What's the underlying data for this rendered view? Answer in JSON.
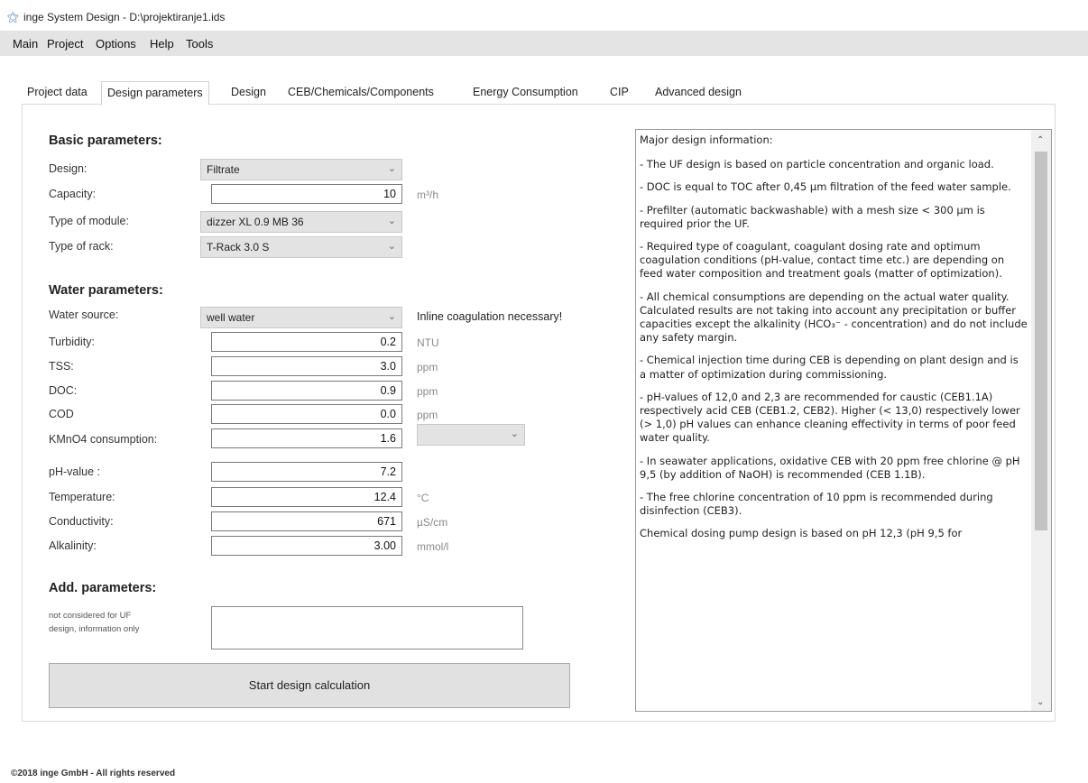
{
  "window": {
    "title": "inge System Design - D:\\projektiranje1.ids",
    "icon": "app-logo-icon"
  },
  "menu": [
    "Main",
    "Project",
    "Options",
    "Help",
    "Tools"
  ],
  "tabs": [
    "Project data",
    "Design parameters",
    "Design",
    "CEB/Chemicals/Components",
    "Energy Consumption",
    "CIP",
    "Advanced design"
  ],
  "active_tab": "Design parameters",
  "basic": {
    "title": "Basic parameters:",
    "design_label": "Design:",
    "design_value": "Filtrate",
    "capacity_label": "Capacity:",
    "capacity_value": "10",
    "capacity_unit": "m³/h",
    "module_label": "Type of module:",
    "module_value": "dizzer XL 0.9 MB 36",
    "rack_label": "Type of rack:",
    "rack_value": "T-Rack 3.0 S"
  },
  "water": {
    "title": "Water parameters:",
    "source_label": "Water source:",
    "source_value": "well water",
    "note": "Inline coagulation necessary!",
    "turbidity_label": "Turbidity:",
    "turbidity_value": "0.2",
    "turbidity_unit": "NTU",
    "tss_label": "TSS:",
    "tss_value": "3.0",
    "tss_unit": "ppm",
    "doc_label": "DOC:",
    "doc_value": "0.9",
    "doc_unit": "ppm",
    "cod_label": "COD",
    "cod_value": "0.0",
    "cod_unit": "ppm",
    "kmno4_label": "KMnO4 consumption:",
    "kmno4_value": "1.6",
    "kmno4_unit_value": "",
    "ph_label": "pH-value :",
    "ph_value": "7.2",
    "temp_label": "Temperature:",
    "temp_value": "12.4",
    "temp_unit": "°C",
    "cond_label": "Conductivity:",
    "cond_value": "671",
    "cond_unit": "µS/cm",
    "alk_label": "Alkalinity:",
    "alk_value": "3.00",
    "alk_unit": "mmol/l"
  },
  "additional": {
    "title": "Add. parameters:",
    "note_line1": "not considered for UF",
    "note_line2": "design, information only",
    "text": ""
  },
  "start_button": "Start design calculation",
  "info": {
    "paragraphs": [
      "Major design information:",
      "- The UF design is based on particle concentration and organic load.",
      "- DOC is equal to TOC after 0,45 µm filtration of the feed water sample.",
      "- Prefilter (automatic backwashable) with a mesh size < 300 µm is required prior the UF.",
      "- Required type of coagulant, coagulant dosing rate and optimum coagulation conditions (pH-value, contact time etc.) are depending on feed water composition and treatment goals (matter of optimization).",
      "- All chemical consumptions are depending on the actual water quality. Calculated results are not taking into account any precipitation or buffer capacities except the alkalinity (HCO₃⁻ - concentration) and do not include any safety margin.",
      "- Chemical injection time during CEB is depending on plant design and is a matter of optimization during commissioning.",
      "- pH-values of 12,0 and 2,3 are recommended for caustic (CEB1.1A) respectively acid CEB (CEB1.2, CEB2). Higher (< 13,0) respectively lower (> 1,0) pH values can enhance cleaning effectivity in terms of poor feed water quality.",
      "- In seawater applications, oxidative CEB with 20 ppm free chlorine @ pH 9,5 (by addition of NaOH) is recommended (CEB 1.1B).",
      "- The free chlorine concentration of 10 ppm is recommended during disinfection (CEB3).",
      "Chemical dosing pump design is based on pH 12,3 (pH 9,5 for"
    ]
  },
  "footer": "©2018 inge GmbH - All rights reserved"
}
